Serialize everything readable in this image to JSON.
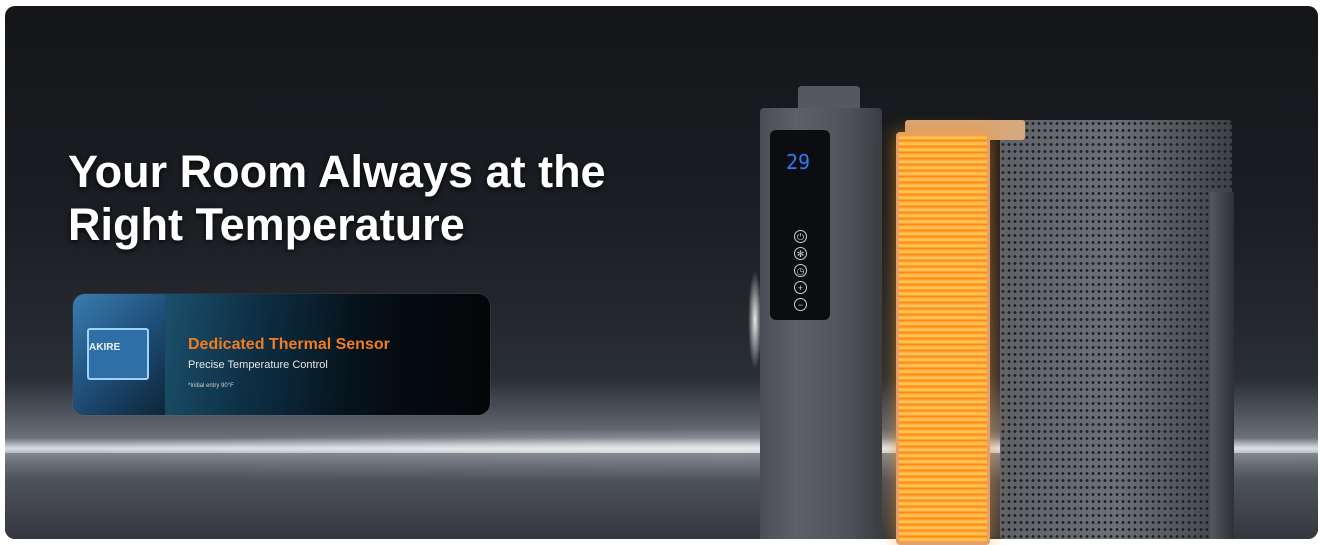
{
  "headline": {
    "line1": "Your Room Always at the",
    "line2": "Right Temperature"
  },
  "feature_card": {
    "chip_label": "AKIRE",
    "title": "Dedicated Thermal Sensor",
    "subtitle": "Precise Temperature Control",
    "note": "*Initial entry 90°F"
  },
  "heater": {
    "display_value": "29",
    "controls": [
      "power-icon",
      "fan-icon",
      "timer-icon",
      "plus-icon",
      "minus-icon"
    ]
  },
  "colors": {
    "accent_orange": "#f07c22",
    "display_blue": "#2b7bff"
  }
}
